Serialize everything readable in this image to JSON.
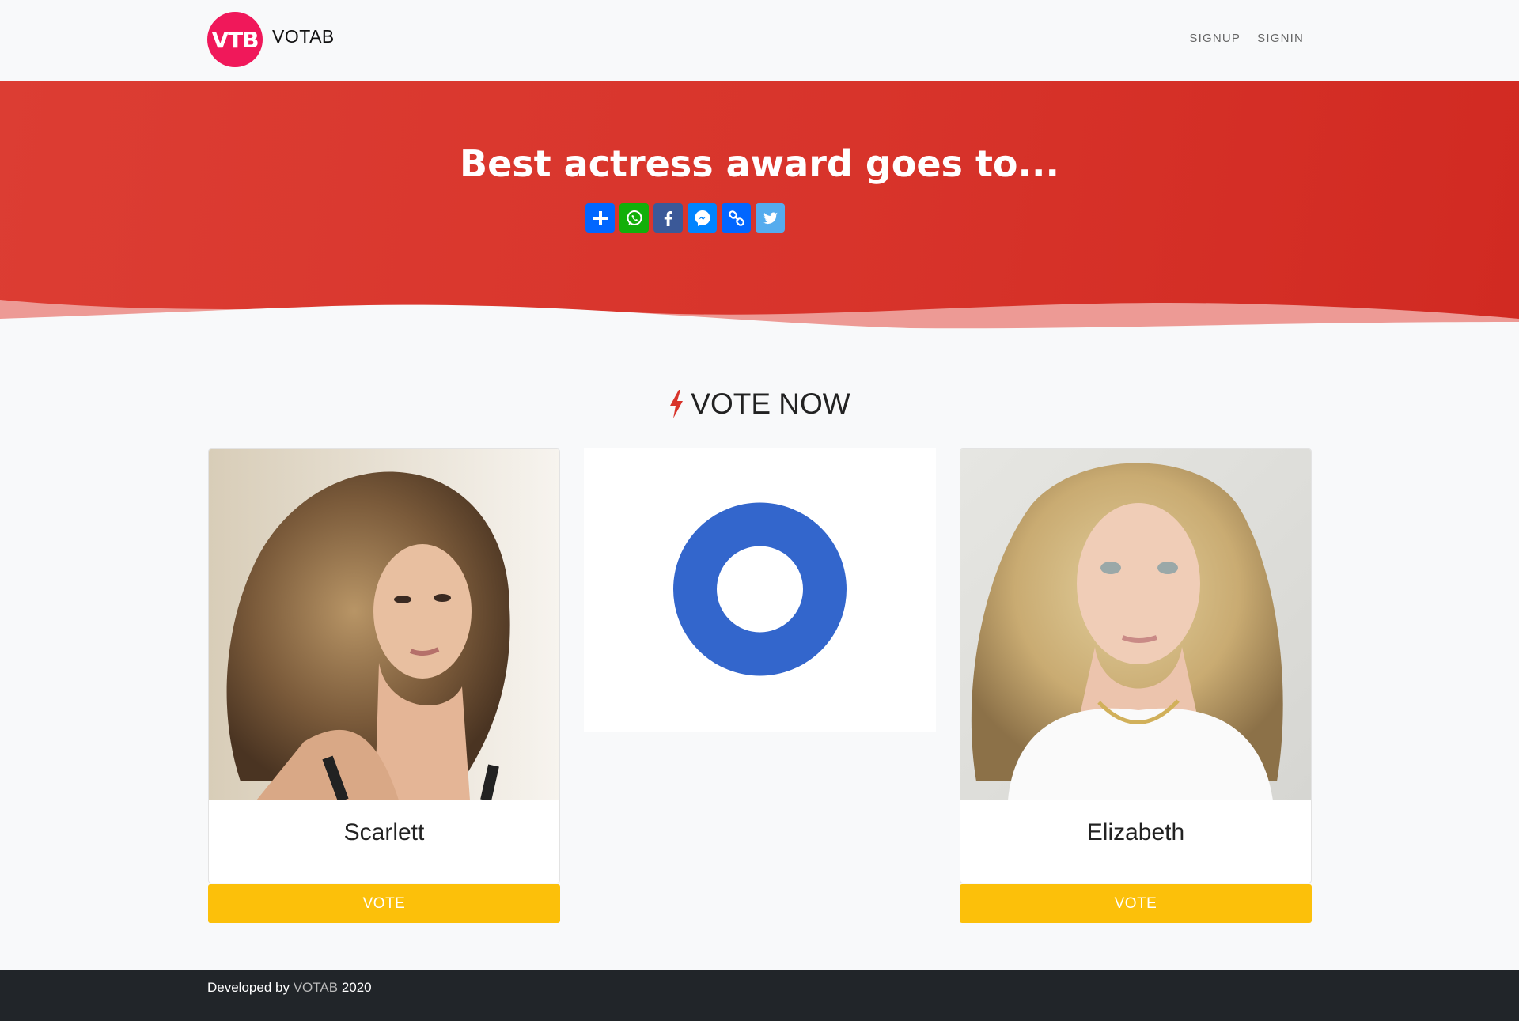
{
  "nav": {
    "logo_text": "VTB",
    "brand": "VOTAB",
    "links": [
      "SIGNUP",
      "SIGNIN"
    ],
    "logo_color": "#f0185a"
  },
  "hero": {
    "title": "Best actress award goes to...",
    "background_color": "#d8342b",
    "share_buttons": [
      {
        "name": "add-to-any",
        "icon": "plus-icon",
        "color": "#0166ff"
      },
      {
        "name": "whatsapp",
        "icon": "whatsapp-icon",
        "color": "#12af0a"
      },
      {
        "name": "facebook",
        "icon": "facebook-icon",
        "color": "#3b5998"
      },
      {
        "name": "messenger",
        "icon": "messenger-icon",
        "color": "#0084ff"
      },
      {
        "name": "copy-link",
        "icon": "link-icon",
        "color": "#0166ff"
      },
      {
        "name": "twitter",
        "icon": "twitter-icon",
        "color": "#55acee"
      }
    ]
  },
  "vote_section": {
    "heading": "VOTE NOW",
    "heading_icon": "bolt-icon",
    "candidates": [
      {
        "name": "Scarlett",
        "vote_label": "VOTE"
      },
      {
        "name": "Elizabeth",
        "vote_label": "VOTE"
      }
    ],
    "vote_button_color": "#fcc00a"
  },
  "chart_data": {
    "type": "pie",
    "categories": [
      "Scarlett",
      "Elizabeth"
    ],
    "values": [
      0,
      0
    ],
    "colors": [
      "#3366cc"
    ],
    "title": "",
    "note_visible": "empty donut ring shown (no votes)"
  },
  "footer": {
    "prefix": "Developed by",
    "brand": "VOTAB",
    "year": "2020"
  }
}
